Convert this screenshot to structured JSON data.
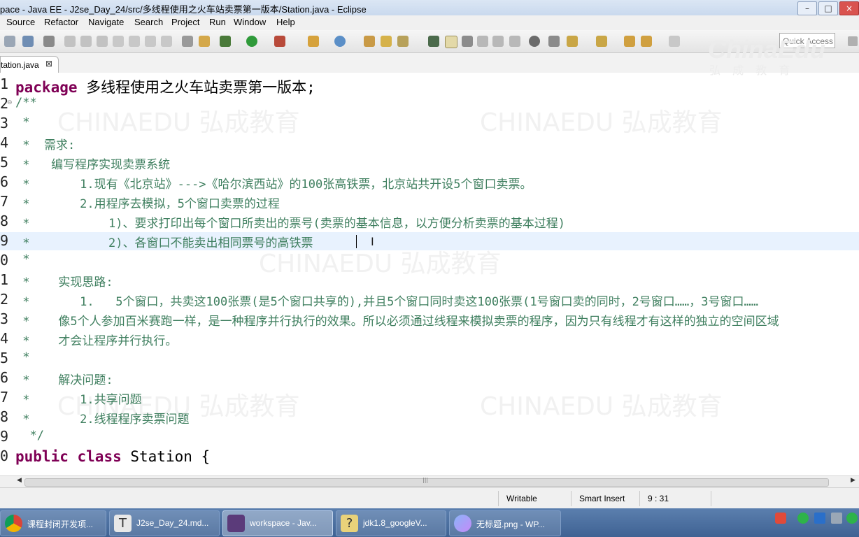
{
  "window": {
    "title": "pace - Java EE - J2se_Day_24/src/多线程使用之火车站卖票第一版本/Station.java - Eclipse"
  },
  "menu": [
    "Source",
    "Refactor",
    "Navigate",
    "Search",
    "Project",
    "Run",
    "Window",
    "Help"
  ],
  "quick_access": {
    "placeholder": "Quick Access"
  },
  "editor_tab": {
    "label": "tation.java",
    "close_icon": "close-icon"
  },
  "watermark": {
    "chinaedu_logo": "ChinaEdu",
    "logo_sub": "弘 成 教 育",
    "bg_text": "CHINAEDU 弘成教育"
  },
  "code_lines": [
    {
      "num": "1",
      "segments": [
        {
          "t": "package",
          "k": "kw"
        },
        {
          "t": " 多线程使用之火车站卖票第一版本;",
          "k": "plain"
        }
      ]
    },
    {
      "num": "2",
      "segments": [
        {
          "t": "/**",
          "k": "c"
        }
      ]
    },
    {
      "num": "3",
      "segments": [
        {
          "t": " *",
          "k": "c"
        }
      ]
    },
    {
      "num": "4",
      "segments": [
        {
          "t": " *  需求:",
          "k": "c"
        }
      ]
    },
    {
      "num": "5",
      "segments": [
        {
          "t": " *   编写程序实现卖票系统",
          "k": "c"
        }
      ]
    },
    {
      "num": "6",
      "segments": [
        {
          "t": " *       1.现有《北京站》--->《哈尔滨西站》的100张高铁票，北京站共开设5个窗口卖票。",
          "k": "c"
        }
      ]
    },
    {
      "num": "7",
      "segments": [
        {
          "t": " *       2.用程序去模拟，5个窗口卖票的过程",
          "k": "c"
        }
      ]
    },
    {
      "num": "8",
      "segments": [
        {
          "t": " *           1)、要求打印出每个窗口所卖出的票号(卖票的基本信息，以方便分析卖票的基本过程)",
          "k": "c"
        }
      ]
    },
    {
      "num": "9",
      "segments": [
        {
          "t": " *           2)、各窗口不能卖出相同票号的高铁票",
          "k": "c"
        }
      ]
    },
    {
      "num": "0",
      "segments": [
        {
          "t": " *",
          "k": "c"
        }
      ]
    },
    {
      "num": "1",
      "segments": [
        {
          "t": " *    实现思路:",
          "k": "c"
        }
      ]
    },
    {
      "num": "2",
      "segments": [
        {
          "t": " *       1.   5个窗口，共卖这100张票(是5个窗口共享的),并且5个窗口同时卖这100张票(1号窗口卖的同时，2号窗口……，3号窗口……",
          "k": "c"
        }
      ]
    },
    {
      "num": "3",
      "segments": [
        {
          "t": " *    像5个人参加百米赛跑一样，是一种程序并行执行的效果。所以必须通过线程来模拟卖票的程序，因为只有线程才有这样的独立的空间区域",
          "k": "c"
        }
      ]
    },
    {
      "num": "4",
      "segments": [
        {
          "t": " *    才会让程序并行执行。",
          "k": "c"
        }
      ]
    },
    {
      "num": "5",
      "segments": [
        {
          "t": " *",
          "k": "c"
        }
      ]
    },
    {
      "num": "6",
      "segments": [
        {
          "t": " *    解决问题:",
          "k": "c"
        }
      ]
    },
    {
      "num": "7",
      "segments": [
        {
          "t": " *       1.共享问题",
          "k": "c"
        }
      ]
    },
    {
      "num": "8",
      "segments": [
        {
          "t": " *       2.线程程序卖票问题",
          "k": "c"
        }
      ]
    },
    {
      "num": "9",
      "segments": [
        {
          "t": "  */",
          "k": "c"
        }
      ]
    },
    {
      "num": "0",
      "segments": [
        {
          "t": "public",
          "k": "kw"
        },
        {
          "t": " ",
          "k": "plain"
        },
        {
          "t": "class",
          "k": "kw"
        },
        {
          "t": " Station {",
          "k": "plain"
        }
      ]
    }
  ],
  "status": {
    "writable": "Writable",
    "insert_mode": "Smart Insert",
    "position": "9 : 31"
  },
  "taskbar": [
    {
      "label": "课程封闭开发项...",
      "icon": "chrome-icon"
    },
    {
      "label": "J2se_Day_24.md...",
      "icon": "typora-icon"
    },
    {
      "label": "workspace - Jav...",
      "icon": "eclipse-icon"
    },
    {
      "label": "jdk1.8_googleV...",
      "icon": "help-file-icon"
    },
    {
      "label": "无标题.png - WP...",
      "icon": "wps-image-icon"
    }
  ],
  "colors": {
    "keyword": "#7f0055",
    "comment": "#3f7f5f",
    "current_line": "#e8f2fe"
  }
}
